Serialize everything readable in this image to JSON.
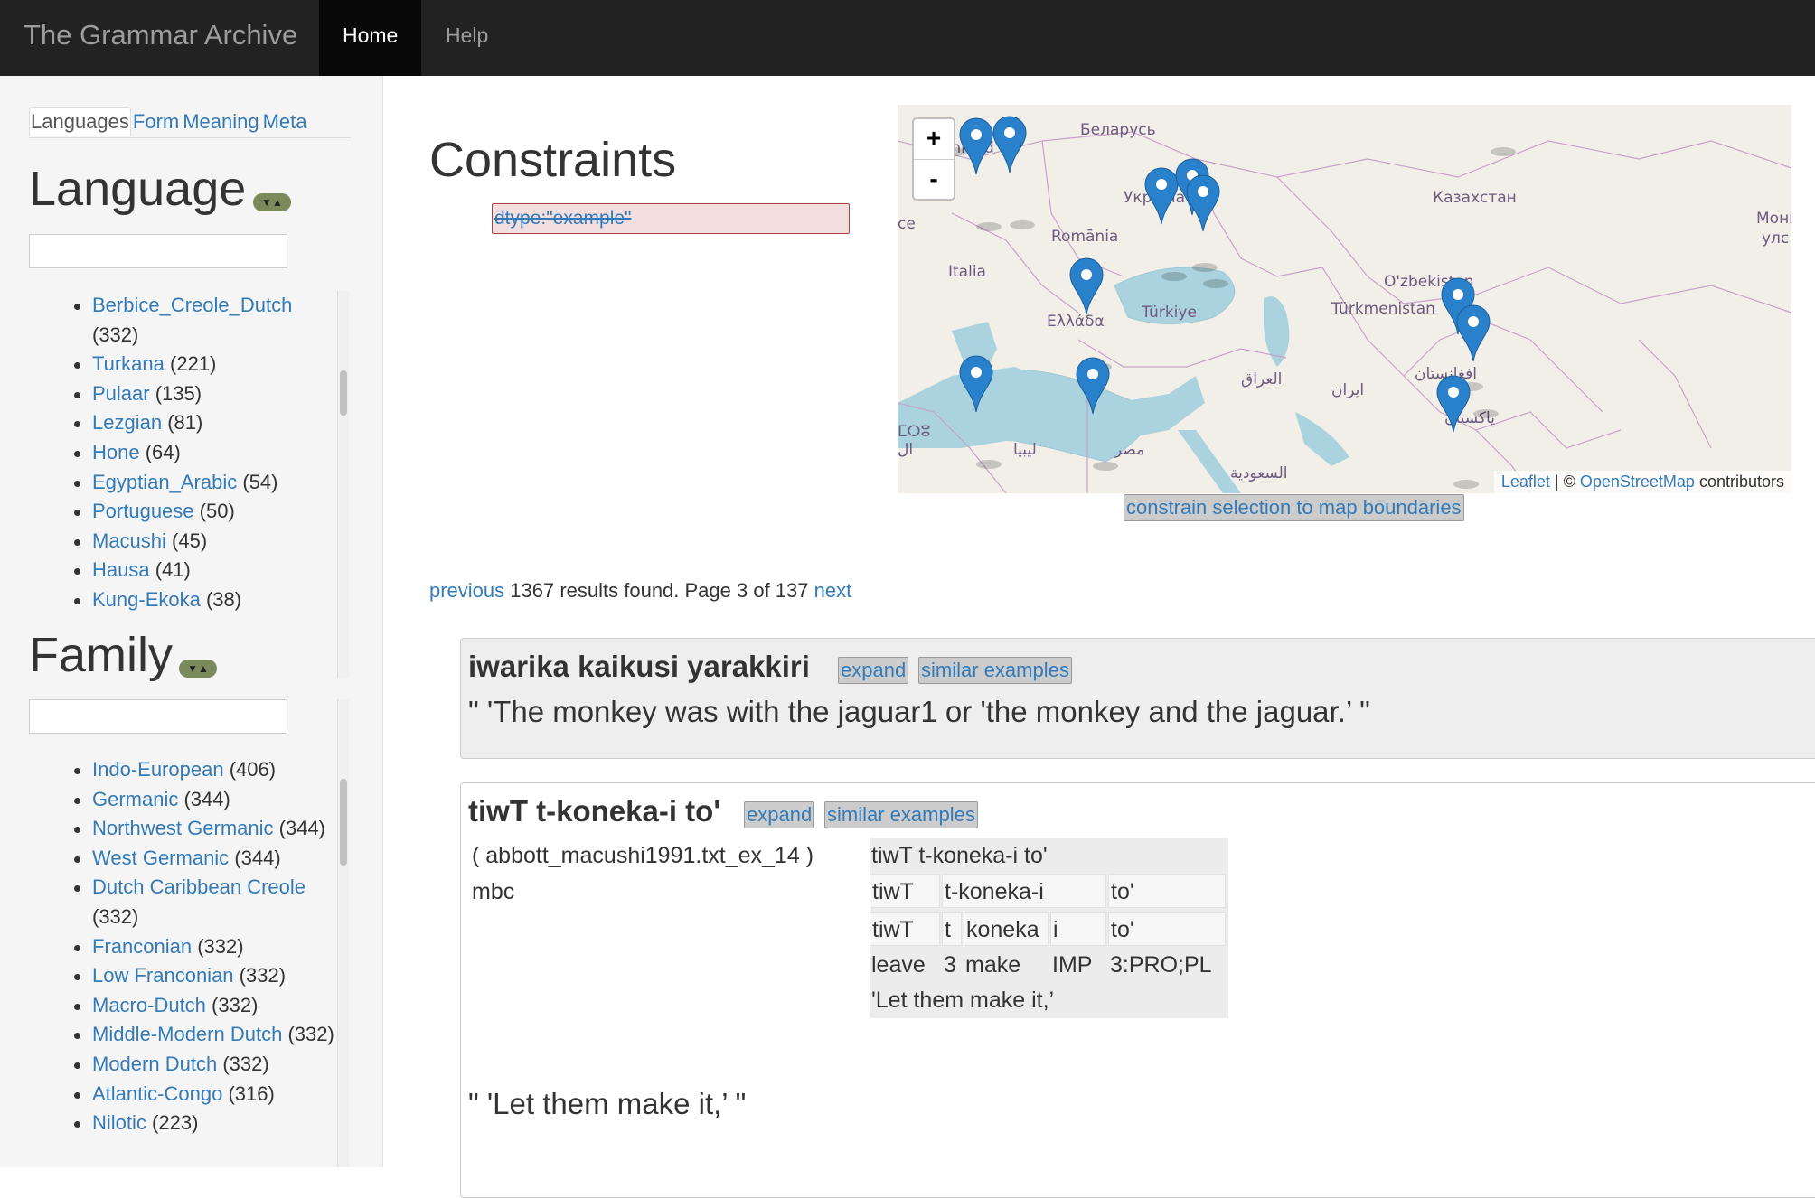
{
  "navbar": {
    "brand": "The Grammar Archive",
    "items": [
      {
        "label": "Home",
        "active": true
      },
      {
        "label": "Help",
        "active": false
      }
    ]
  },
  "sidebar": {
    "tabs": [
      "Languages",
      "Form",
      "Meaning",
      "Meta"
    ],
    "active_tab": "Languages",
    "language": {
      "title": "Language",
      "toggle_glyph": "▼▲",
      "items": [
        {
          "name": "Berbice_Creole_Dutch",
          "count": "(332)"
        },
        {
          "name": "Turkana",
          "count": "(221)"
        },
        {
          "name": "Pulaar",
          "count": "(135)"
        },
        {
          "name": "Lezgian",
          "count": "(81)"
        },
        {
          "name": "Hone",
          "count": "(64)"
        },
        {
          "name": "Egyptian_Arabic",
          "count": "(54)"
        },
        {
          "name": "Portuguese",
          "count": "(50)"
        },
        {
          "name": "Macushi",
          "count": "(45)"
        },
        {
          "name": "Hausa",
          "count": "(41)"
        },
        {
          "name": "Kung-Ekoka",
          "count": "(38)"
        }
      ]
    },
    "family": {
      "title": "Family",
      "toggle_glyph": "▼▲",
      "items": [
        {
          "name": "Indo-European",
          "count": "(406)"
        },
        {
          "name": "Germanic",
          "count": "(344)"
        },
        {
          "name": "Northwest Germanic",
          "count": "(344)"
        },
        {
          "name": "West Germanic",
          "count": "(344)"
        },
        {
          "name": "Dutch Caribbean Creole",
          "count": "(332)"
        },
        {
          "name": "Franconian",
          "count": "(332)"
        },
        {
          "name": "Low Franconian",
          "count": "(332)"
        },
        {
          "name": "Macro-Dutch",
          "count": "(332)"
        },
        {
          "name": "Middle-Modern Dutch",
          "count": "(332)"
        },
        {
          "name": "Modern Dutch",
          "count": "(332)"
        },
        {
          "name": "Atlantic-Congo",
          "count": "(316)"
        },
        {
          "name": "Nilotic",
          "count": "(223)"
        }
      ]
    }
  },
  "main": {
    "constraints_title": "Constraints",
    "constraint": "dtype:\"example\"",
    "map": {
      "zoom_in": "+",
      "zoom_out": "-",
      "attribution_leaflet": "Leaflet",
      "attribution_sep": " | © ",
      "attribution_osm": "OpenStreetMap",
      "attribution_tail": " contributors",
      "constrain_button": "constrain selection to map boundaries",
      "labels": [
        "chland",
        "Беларусь",
        "Україна",
        "Казахстан",
        "Romānia",
        "Italia",
        "Türkiye",
        "Ελλάδα",
        "O'zbekiston",
        "Türkmenistan",
        "العراق",
        "ایران",
        "افغانستان",
        "پاکستان",
        "السعودية",
        "ليبيا",
        "مصر",
        "Монг",
        "улс",
        "ce",
        "ⵎⵔⵓ",
        "ال"
      ]
    },
    "pager": {
      "previous": "previous",
      "status": " 1367 results found. Page 3 of 137 ",
      "next": "next"
    },
    "results": [
      {
        "title": "iwarika kaikusi yarakkiri",
        "expand": "expand",
        "similar": "similar examples",
        "translation": "\" 'The monkey was with the jaguar1 or 'the monkey and the jaguar.’ \""
      },
      {
        "title": "tiwT t-koneka-i to'",
        "expand": "expand",
        "similar": "similar examples",
        "source": "( abbott_macushi1991.txt_ex_14 )",
        "lang_code": "mbc",
        "igt": {
          "line": "tiwT t-koneka-i to'",
          "words": [
            "tiwT",
            "t-koneka-i",
            "to'"
          ],
          "morphs": [
            "tiwT",
            "t",
            "koneka",
            "i",
            "to'"
          ],
          "glosses": [
            "leave",
            "3",
            "make",
            "IMP",
            "3:PRO;PL"
          ],
          "free": "'Let them make it,’"
        },
        "translation": "\" 'Let them make it,’ \""
      }
    ]
  }
}
